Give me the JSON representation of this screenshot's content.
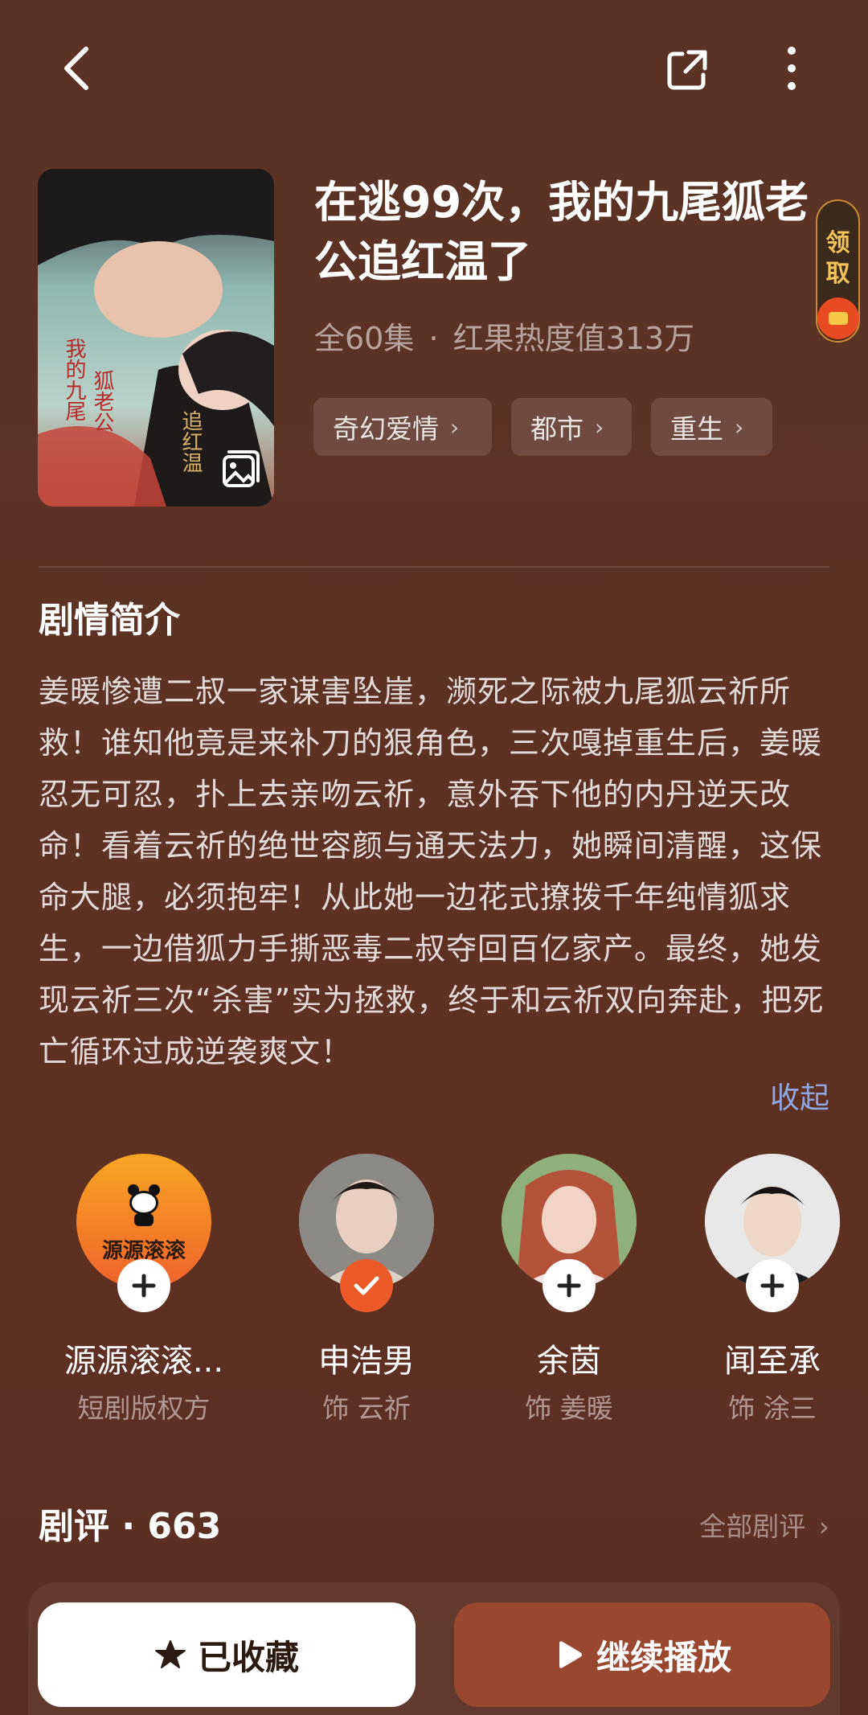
{
  "header": {
    "back_icon": "chevron-left-icon",
    "share_icon": "share-icon",
    "more_icon": "more-vertical-icon"
  },
  "poster": {
    "corner_icon": "image-icon"
  },
  "drama": {
    "title": "在逃99次，我的九尾狐老公追红温了",
    "episodes": "全60集",
    "separator": "·",
    "heat": "红果热度值313万",
    "tags": [
      "奇幻爱情",
      "都市",
      "重生"
    ]
  },
  "reward_badge": {
    "chars": [
      "领",
      "取"
    ]
  },
  "synopsis": {
    "heading": "剧情简介",
    "text": "姜暖惨遭二叔一家谋害坠崖，濒死之际被九尾狐云祈所救！谁知他竟是来补刀的狠角色，三次嘎掉重生后，姜暖忍无可忍，扑上去亲吻云祈，意外吞下他的内丹逆天改命！看着云祈的绝世容颜与通天法力，她瞬间清醒，这保命大腿，必须抱牢！从此她一边花式撩拨千年纯情狐求生，一边借狐力手撕恶毒二叔夺回百亿家产。最终，她发现云祈三次“杀害”实为拯救，终于和云祈双向奔赴，把死亡循环过成逆袭爽文！",
    "collapse_label": "收起"
  },
  "cast": [
    {
      "name": "源源滚滚...",
      "role": "短剧版权方",
      "followed": false,
      "logo_text": "源源滚滚"
    },
    {
      "name": "申浩男",
      "role": "饰 云祈",
      "followed": true
    },
    {
      "name": "余茵",
      "role": "饰 姜暖",
      "followed": false
    },
    {
      "name": "闻至承",
      "role": "饰 涂三",
      "followed": false
    }
  ],
  "reviews": {
    "heading": "剧评 · 663",
    "all_label": "全部剧评"
  },
  "actions": {
    "collect_label": "已收藏",
    "play_label": "继续播放"
  },
  "colors": {
    "background": "#5b3224",
    "accent_orange": "#ec5a2a",
    "play_button": "#9a4730",
    "link_blue": "#8fa6e0"
  }
}
